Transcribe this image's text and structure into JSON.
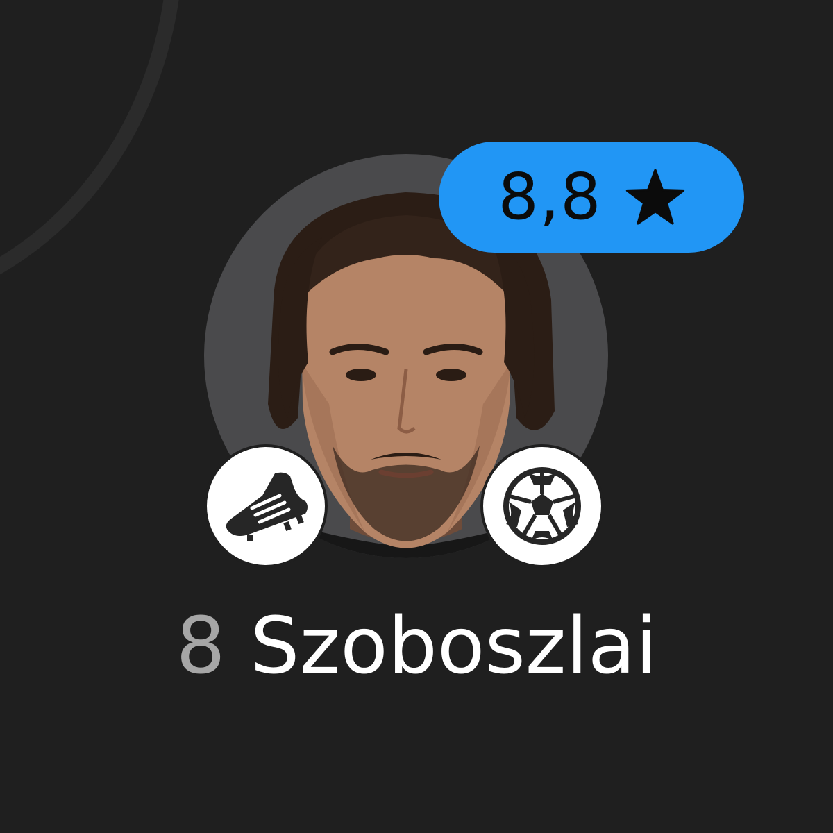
{
  "player": {
    "number": "8",
    "name": "Szoboszlai",
    "rating": "8,8"
  },
  "icons": {
    "rating": "star-icon",
    "event_left": "football-boot-icon",
    "event_right": "football-ball-icon"
  },
  "colors": {
    "background": "#1f1f1f",
    "rating_badge": "#2196f5",
    "avatar_background": "#4a4a4c",
    "number": "#a6a6a6",
    "name": "#ffffff"
  }
}
